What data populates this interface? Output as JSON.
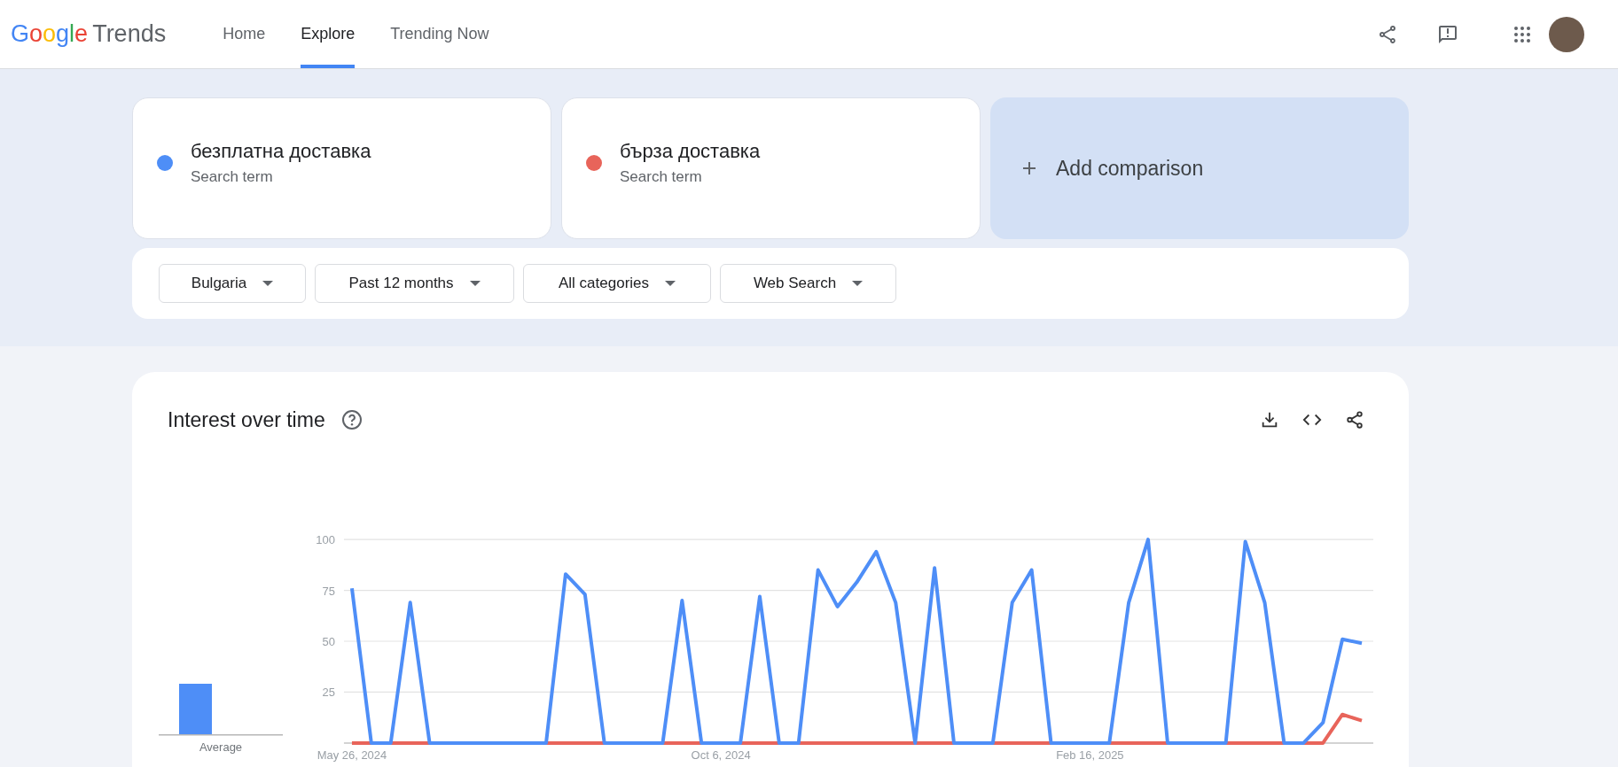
{
  "header": {
    "logo": {
      "brand": "Google",
      "product": "Trends"
    },
    "nav": [
      {
        "label": "Home",
        "selected": false
      },
      {
        "label": "Explore",
        "selected": true
      },
      {
        "label": "Trending Now",
        "selected": false
      }
    ]
  },
  "search_terms": [
    {
      "term": "безплатна доставка",
      "type": "Search term",
      "color": "#4e8ef7"
    },
    {
      "term": "бърза доставка",
      "type": "Search term",
      "color": "#e8645a"
    }
  ],
  "add_comparison": "Add comparison",
  "filters": [
    "Bulgaria",
    "Past 12 months",
    "All categories",
    "Web Search"
  ],
  "interest_over_time": {
    "title": "Interest over time",
    "average_label": "Average",
    "chart_data": {
      "type": "line",
      "grid": true,
      "ylim": [
        0,
        100
      ],
      "yticks": [
        25,
        50,
        75,
        100
      ],
      "categories": [
        "May 26, 2024",
        null,
        null,
        null,
        null,
        null,
        null,
        null,
        null,
        null,
        null,
        null,
        null,
        null,
        null,
        null,
        null,
        null,
        null,
        "Oct 6, 2024",
        null,
        null,
        null,
        null,
        null,
        null,
        null,
        null,
        null,
        null,
        null,
        null,
        null,
        null,
        null,
        null,
        null,
        null,
        "Feb 16, 2025",
        null,
        null,
        null,
        null,
        null,
        null,
        null,
        null,
        null,
        null,
        null,
        null,
        null,
        null
      ],
      "series": [
        {
          "color": "#4e8ef7",
          "values": [
            76,
            0,
            0,
            69,
            0,
            0,
            0,
            0,
            0,
            0,
            0,
            83,
            73,
            0,
            0,
            0,
            0,
            70,
            0,
            0,
            0,
            72,
            0,
            0,
            85,
            67,
            79,
            94,
            69,
            0,
            86,
            0,
            0,
            0,
            69,
            85,
            0,
            0,
            0,
            0,
            69,
            100,
            0,
            0,
            0,
            0,
            99,
            69,
            0,
            0,
            10,
            51,
            49
          ]
        },
        {
          "color": "#e8645a",
          "values": [
            0,
            0,
            0,
            0,
            0,
            0,
            0,
            0,
            0,
            0,
            0,
            0,
            0,
            0,
            0,
            0,
            0,
            0,
            0,
            0,
            0,
            0,
            0,
            0,
            0,
            0,
            0,
            0,
            0,
            0,
            0,
            0,
            0,
            0,
            0,
            0,
            0,
            0,
            0,
            0,
            0,
            0,
            0,
            0,
            0,
            0,
            0,
            0,
            0,
            0,
            0,
            14,
            11
          ]
        }
      ]
    }
  }
}
